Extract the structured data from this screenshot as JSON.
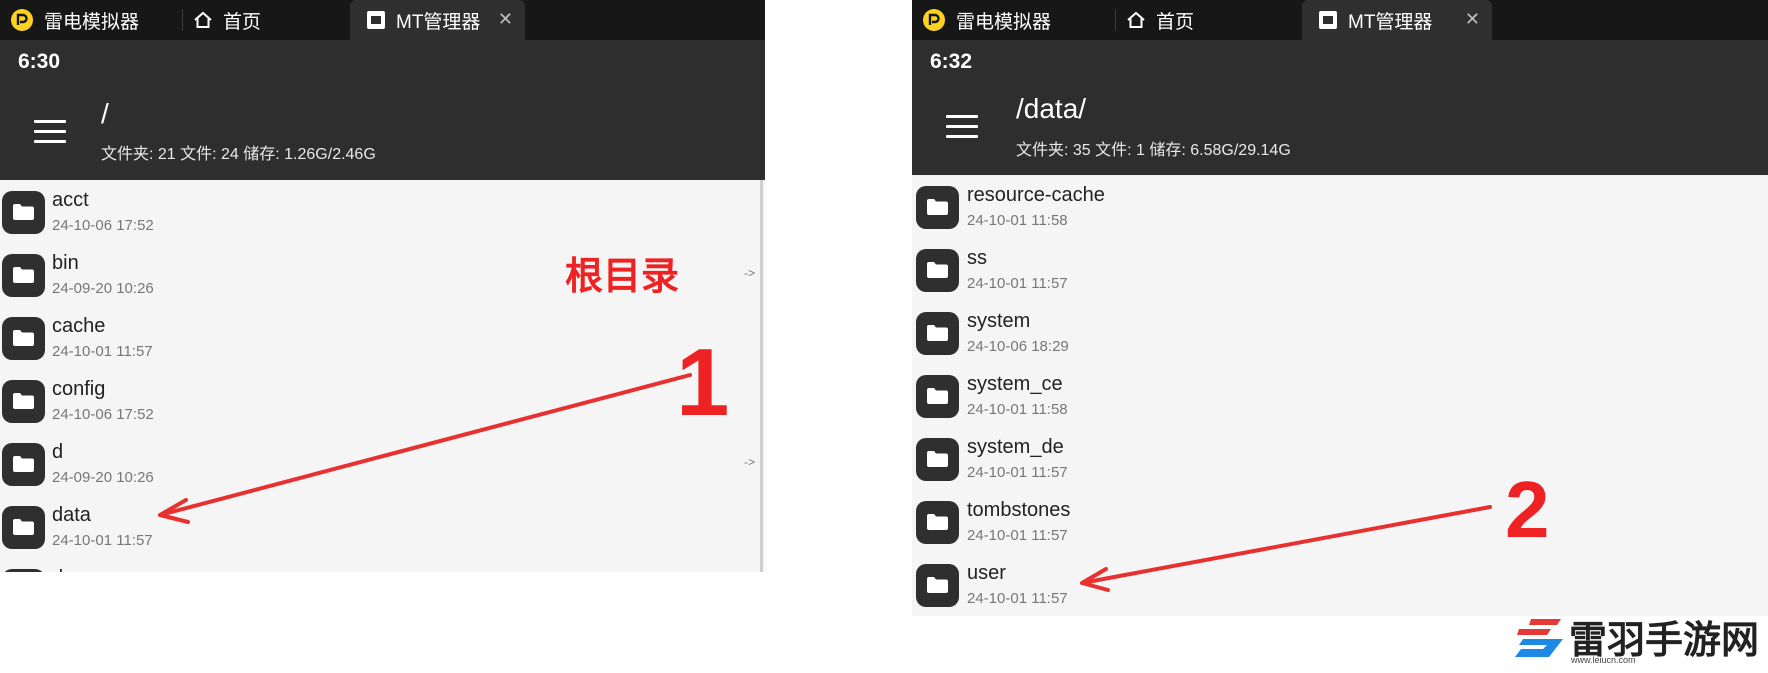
{
  "panels": [
    {
      "tabs": {
        "emulator": "雷电模拟器",
        "home": "首页",
        "app": "MT管理器"
      },
      "clock": "6:30",
      "path": "/",
      "stats": "文件夹: 21  文件: 24  储存: 1.26G/2.46G",
      "files": [
        {
          "name": "acct",
          "date": "24-10-06 17:52",
          "link": ""
        },
        {
          "name": "bin",
          "date": "24-09-20 10:26",
          "link": "->"
        },
        {
          "name": "cache",
          "date": "24-10-01 11:57",
          "link": ""
        },
        {
          "name": "config",
          "date": "24-10-06 17:52",
          "link": ""
        },
        {
          "name": "d",
          "date": "24-09-20 10:26",
          "link": "->"
        },
        {
          "name": "data",
          "date": "24-10-01 11:57",
          "link": ""
        },
        {
          "name": "d",
          "date": "",
          "link": ""
        }
      ],
      "annotation_label": "根目录",
      "step_number": "1"
    },
    {
      "tabs": {
        "emulator": "雷电模拟器",
        "home": "首页",
        "app": "MT管理器"
      },
      "clock": "6:32",
      "path": "/data/",
      "stats": "文件夹: 35  文件: 1  储存: 6.58G/29.14G",
      "files": [
        {
          "name": "resource-cache",
          "date": "24-10-01 11:58",
          "link": ""
        },
        {
          "name": "ss",
          "date": "24-10-01 11:57",
          "link": ""
        },
        {
          "name": "system",
          "date": "24-10-06 18:29",
          "link": ""
        },
        {
          "name": "system_ce",
          "date": "24-10-01 11:58",
          "link": ""
        },
        {
          "name": "system_de",
          "date": "24-10-01 11:57",
          "link": ""
        },
        {
          "name": "tombstones",
          "date": "24-10-01 11:57",
          "link": ""
        },
        {
          "name": "user",
          "date": "24-10-01 11:57",
          "link": ""
        }
      ],
      "step_number": "2"
    }
  ],
  "watermark": {
    "text": "雷羽手游网",
    "url": "www.leiucn.com"
  },
  "colors": {
    "accent": "#ee2222",
    "bar": "#2e2e2e",
    "tabbar": "#171717",
    "list_bg": "#f5f5f5"
  }
}
